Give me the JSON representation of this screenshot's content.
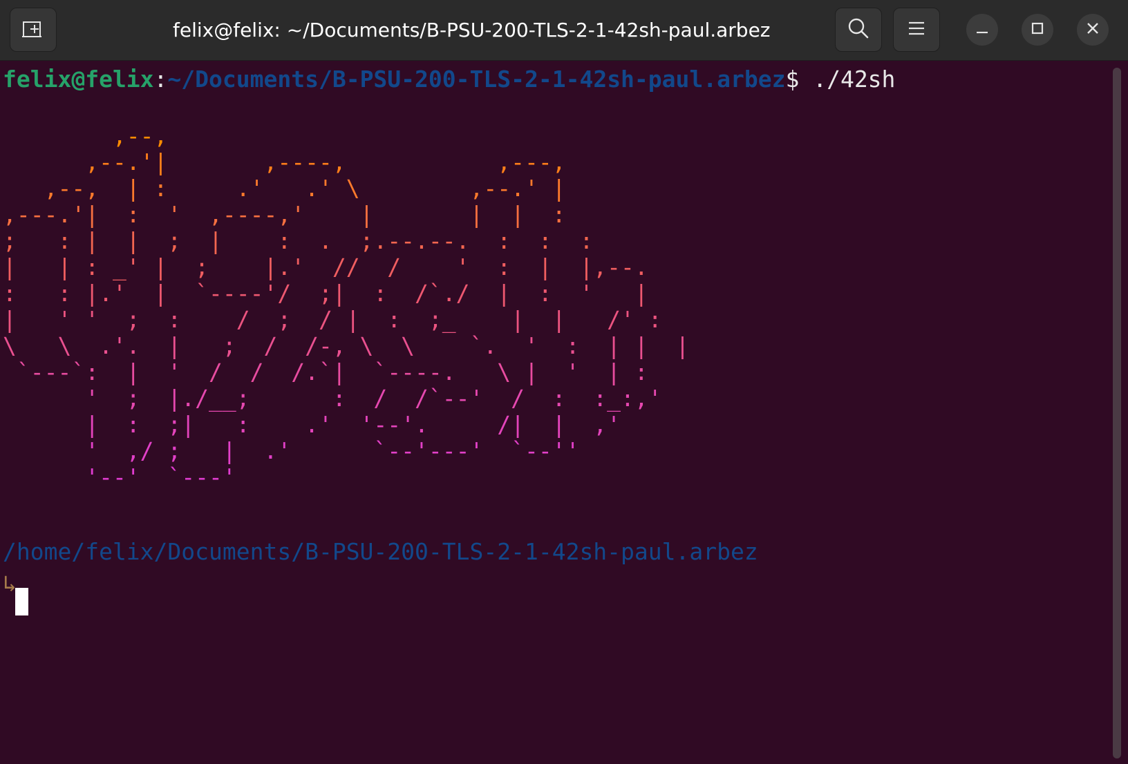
{
  "window": {
    "title": "felix@felix: ~/Documents/B-PSU-200-TLS-2-1-42sh-paul.arbez"
  },
  "titlebar_icons": {
    "new_tab": "new-tab-icon",
    "search": "search-icon",
    "menu": "hamburger-menu-icon",
    "minimize": "minimize-icon",
    "maximize": "maximize-icon",
    "close": "close-icon"
  },
  "prompt": {
    "user_host": "felix@felix",
    "separator": ":",
    "path": "~/Documents/B-PSU-200-TLS-2-1-42sh-paul.arbez",
    "symbol": "$",
    "command": " ./42sh"
  },
  "banner": {
    "lines": [
      "        ,--,",
      "      ,--.'|       ,----,           ,---,",
      "   ,--,  | :     .'   .' \\        ,--.' |",
      ",---.'|  :  '  ,----,'    |       |  |  :",
      ";   : |  |  ;  |    :  .  ;.--.--.  :  :  :",
      "|   | : _' |  ;    |.'  //  /    '  :  |  |,--.",
      ":   : |.'  |  `----'/  ;|  :  /`./  |  :  '   |",
      "|   ' '  ;  :    /  ;  / |  :  ;_    |  |   /' :",
      "\\   \\  .'.  |   ;  /  /-, \\  \\    `.  '  :  | |  |",
      " `---`:  |  '  /  /  /.`|  `----.   \\ |  '  | :",
      "      '  ;  |./__;      :  /  /`--'  /  :  :_:,'",
      "      |  :  ;|   :    .'  '--'.     /|  |  ,'",
      "      '  ,/ ;   |  .'      `--'---'  `--''",
      "      '--'  `---'"
    ],
    "colors": [
      "#ff8c00",
      "#ff7f1a",
      "#fb7a2c",
      "#f77040",
      "#f36650",
      "#f05e60",
      "#ee5870",
      "#ec5480",
      "#ea5090",
      "#e84ca0",
      "#e648b0",
      "#e444bc",
      "#e240c8",
      "#e03cd0"
    ]
  },
  "cwd_line": "/home/felix/Documents/B-PSU-200-TLS-2-1-42sh-paul.arbez",
  "input_prompt": "↳",
  "colors": {
    "background": "#300a24",
    "titlebar": "#2b2b2b",
    "user_host": "#26a269",
    "path": "#12488b",
    "cwd": "#12488b",
    "input_prompt": "#a57a4a",
    "text": "#e8e8e8"
  }
}
